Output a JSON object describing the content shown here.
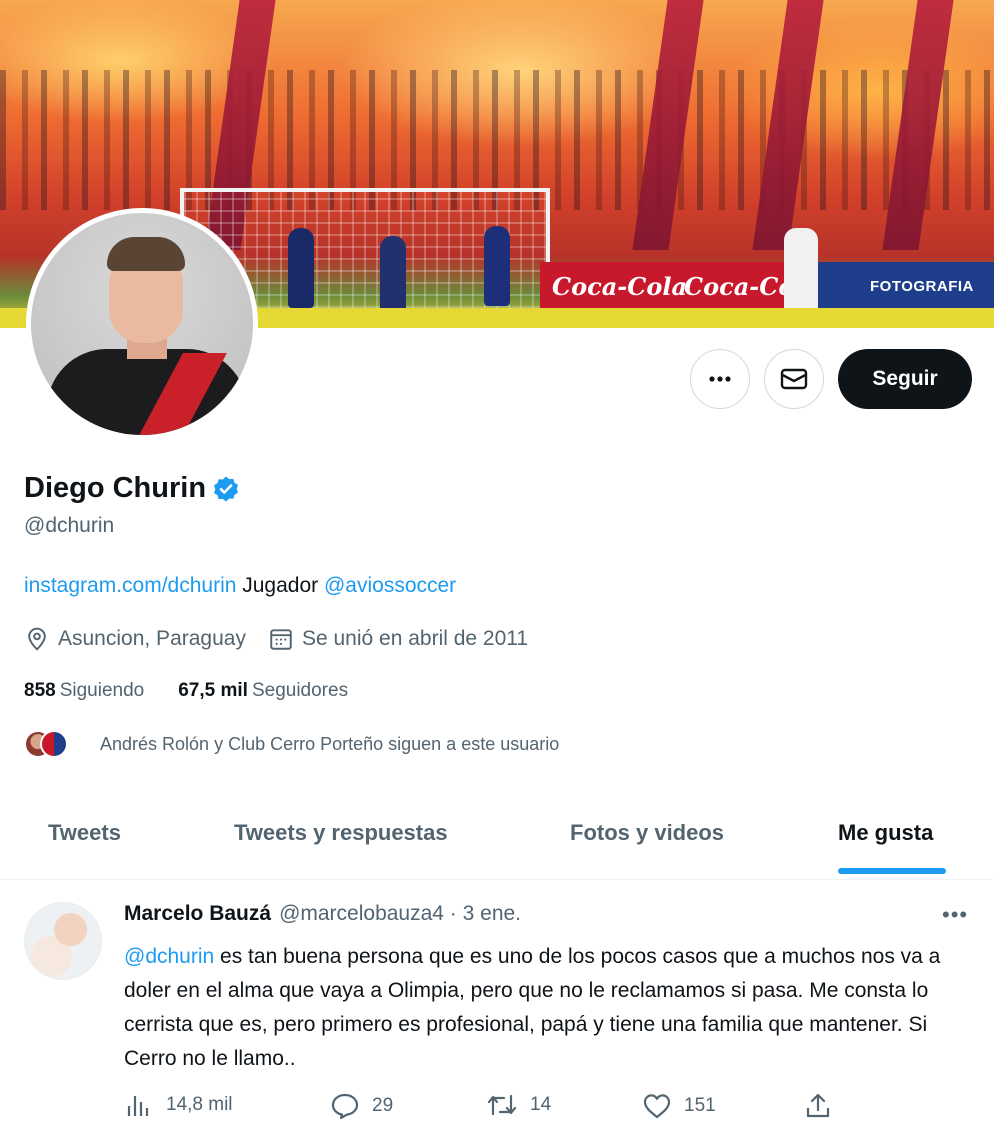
{
  "profile": {
    "name": "Diego Churin",
    "handle": "@dchurin",
    "bio_link": "instagram.com/dchurin",
    "bio_text": " Jugador ",
    "bio_mention": "@aviossoccer",
    "location": "Asuncion, Paraguay",
    "joined": "Se unió en abril de 2011",
    "following_count": "858",
    "following_label": "Siguiendo",
    "followers_count": "67,5 mil",
    "followers_label": "Seguidores",
    "known_followers": "Andrés Rolón y Club Cerro Porteño siguen a este usuario"
  },
  "actions": {
    "follow_label": "Seguir",
    "more_icon": "more-icon",
    "message_icon": "envelope-icon"
  },
  "banner": {
    "ad1": "Coca-Cola",
    "ad2": "Coca-Cola",
    "ad3": "FOTOGRAFIA"
  },
  "tabs": [
    "Tweets",
    "Tweets y respuestas",
    "Fotos y videos",
    "Me gusta"
  ],
  "active_tab": "Me gusta",
  "tweet": {
    "author": "Marcelo Bauzá",
    "author_handle_date": "@marcelobauza4 · 3 ene.",
    "mention": "@dchurin",
    "text": " es tan buena persona que es uno de los pocos casos que a muchos nos va a doler en el alma que vaya a Olimpia, pero que no le reclamamos si pasa. Me consta lo cerrista que es, pero primero es profesional, papá y tiene una familia que mantener. Si Cerro no le llamo..",
    "views": "14,8 mil",
    "replies": "29",
    "retweets": "14",
    "likes": "151"
  },
  "colors": {
    "accent": "#1d9bf0",
    "text": "#0f1419",
    "secondary": "#536471"
  }
}
